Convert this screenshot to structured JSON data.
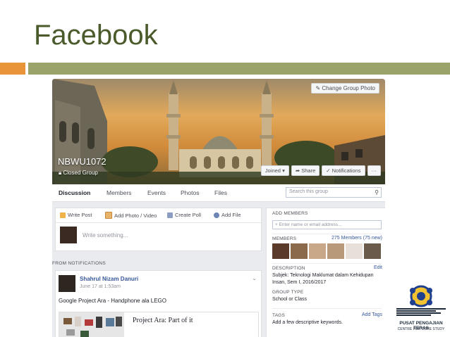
{
  "slide": {
    "title": "Facebook"
  },
  "cover": {
    "change_photo": "Change Group Photo",
    "group_name": "NBWU1072",
    "group_type": "Closed Group",
    "buttons": {
      "joined": "Joined",
      "share": "Share",
      "notifications": "Notifications",
      "more": "···"
    }
  },
  "tabs": [
    "Discussion",
    "Members",
    "Events",
    "Photos",
    "Files"
  ],
  "search": {
    "placeholder": "Search this group"
  },
  "composer": {
    "actions": {
      "write_post": "Write Post",
      "add_photo": "Add Photo / Video",
      "create_poll": "Create Poll",
      "add_file": "Add File"
    },
    "placeholder": "Write something..."
  },
  "feed": {
    "section_label": "FROM NOTIFICATIONS",
    "post": {
      "author": "Shahrul Nizam Danuri",
      "time": "June 17 at 1:53am",
      "text": "Google Project Ara - Handphone ala LEGO",
      "link_title": "Project Ara: Part of it"
    }
  },
  "sidebar": {
    "add_members_label": "ADD MEMBERS",
    "add_members_placeholder": "+ Enter name or email address...",
    "members_label": "MEMBERS",
    "members_count": "275 Members (75 new)",
    "description_label": "DESCRIPTION",
    "edit": "Edit",
    "description_line1": "Subjek: Teknologi Maklumat dalam Kehidupan",
    "description_line2": "Insan, Sem I, 2016/2017",
    "group_type_label": "GROUP TYPE",
    "group_type_value": "School or Class",
    "tags_label": "TAGS",
    "add_tags": "Add Tags",
    "tags_value": "Add a few descriptive keywords."
  },
  "logo": {
    "line1": "PUSAT PENGAJIAN TERAS",
    "line2": "CENTRE FOR CORE STUDY"
  },
  "colors": {
    "title": "#4a5a2a",
    "orange_bar": "#e8953a",
    "olive_bar": "#9aa46a",
    "fb_link": "#365899"
  }
}
